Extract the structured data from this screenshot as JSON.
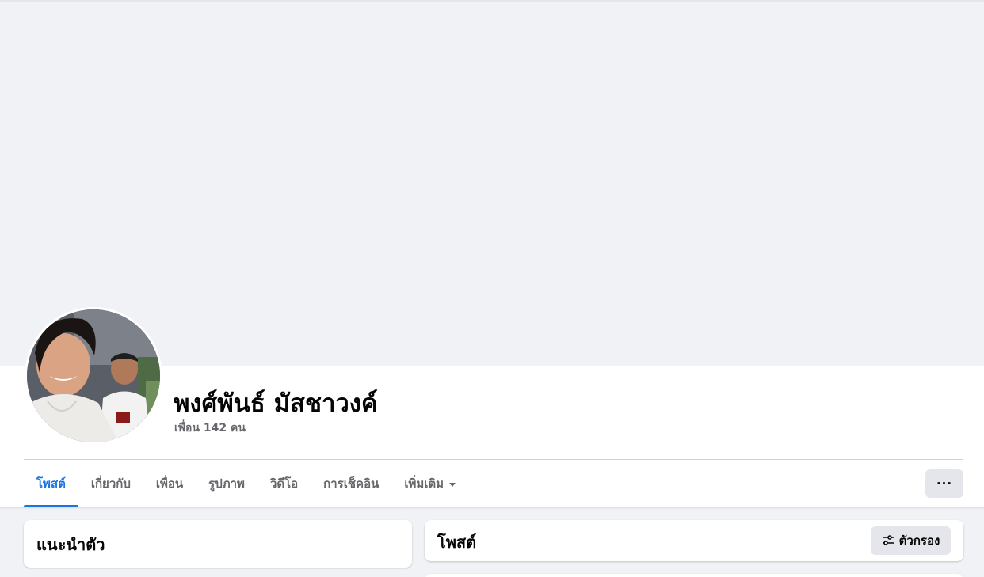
{
  "profile": {
    "name": "พงศ์พันธ์ มัสชาวงค์",
    "friends_text": "เพื่อน 142 คน"
  },
  "tabs": [
    {
      "label": "โพสต์",
      "active": true
    },
    {
      "label": "เกี่ยวกับ",
      "active": false
    },
    {
      "label": "เพื่อน",
      "active": false
    },
    {
      "label": "รูปภาพ",
      "active": false
    },
    {
      "label": "วิดีโอ",
      "active": false
    },
    {
      "label": "การเช็คอิน",
      "active": false
    },
    {
      "label": "เพิ่มเติม",
      "active": false,
      "has_caret": true
    }
  ],
  "header": {
    "more_button_label": "···"
  },
  "intro": {
    "title": "แนะนำตัว"
  },
  "posts": {
    "title": "โพสต์",
    "filter_label": "ตัวกรอง",
    "filter_icon": "filter-sliders-icon"
  },
  "colors": {
    "accent": "#1b74e4",
    "page_bg": "#f0f2f5",
    "secondary_text": "#65676b",
    "button_bg": "#e4e6eb"
  }
}
